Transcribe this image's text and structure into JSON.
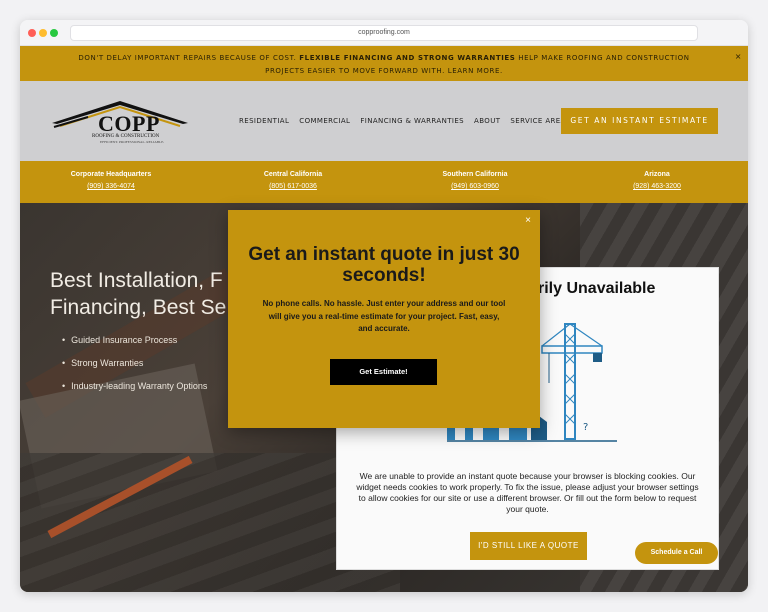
{
  "browser": {
    "url": "copproofing.com"
  },
  "announcement": {
    "text_before": "DON'T DELAY IMPORTANT REPAIRS BECAUSE OF COST.",
    "text_bold": "FLEXIBLE FINANCING AND STRONG WARRANTIES",
    "text_after": "HELP MAKE ROOFING AND CONSTRUCTION PROJECTS EASIER TO MOVE FORWARD WITH.",
    "link": "LEARN MORE.",
    "close": "×"
  },
  "logo": {
    "name": "COPP",
    "sub": "ROOFING & CONSTRUCTION",
    "tagline": "EFFICIENT. PROFESSIONAL. RELIABLE."
  },
  "nav": {
    "items": [
      "RESIDENTIAL",
      "COMMERCIAL",
      "FINANCING & WARRANTIES",
      "ABOUT",
      "SERVICE AREAS"
    ],
    "cta": "GET AN INSTANT ESTIMATE"
  },
  "locations": [
    {
      "name": "Corporate Headquarters",
      "phone": "(909) 336-4074"
    },
    {
      "name": "Central California",
      "phone": "(805) 617-0036"
    },
    {
      "name": "Southern California",
      "phone": "(949) 603-0960"
    },
    {
      "name": "Arizona",
      "phone": "(928) 463-3200"
    }
  ],
  "hero": {
    "title_line1": "Best Installation, F",
    "title_line2": "Financing, Best Se",
    "bullets": [
      "Guided Insurance Process",
      "Strong Warranties",
      "Industry-leading Warranty Options"
    ]
  },
  "widget": {
    "heading": "rily Unavailable",
    "message": "We are unable to provide an instant quote because your browser is blocking cookies. Our widget needs cookies to work properly. To fix the issue, please adjust your browser settings to allow cookies for our site or use a different browser. Or fill out the form below to request your quote.",
    "button": "I'D STILL LIKE A QUOTE"
  },
  "modal": {
    "title": "Get an instant quote in just 30 seconds!",
    "description": "No phone calls. No hassle. Just enter your address and our tool will give you a real-time estimate for your project. Fast, easy, and accurate.",
    "button": "Get Estimate!",
    "close": "×"
  },
  "schedule_button": "Schedule a Call",
  "colors": {
    "accent": "#c4940e",
    "header_bg": "#cfcfd1"
  }
}
